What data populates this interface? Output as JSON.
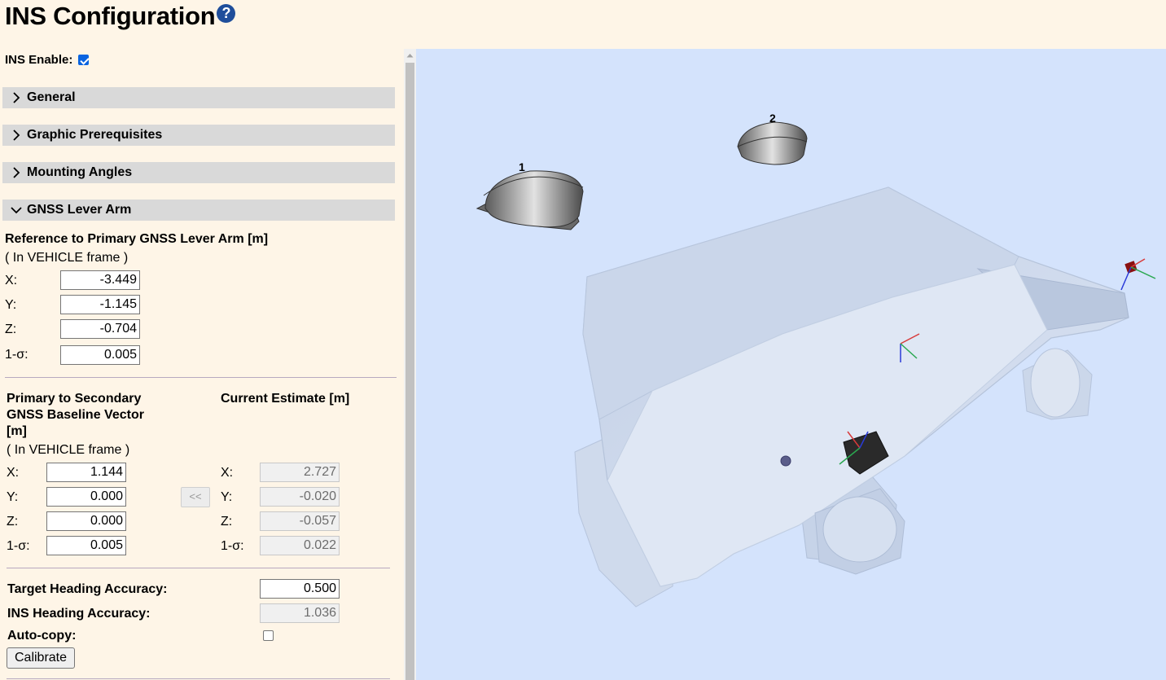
{
  "page": {
    "title": "INS Configuration",
    "help_glyph": "?"
  },
  "ins_enable": {
    "label": "INS Enable:",
    "checked": true
  },
  "sections": [
    {
      "label": "General",
      "expanded": false
    },
    {
      "label": "Graphic Prerequisites",
      "expanded": false
    },
    {
      "label": "Mounting Angles",
      "expanded": false
    },
    {
      "label": "GNSS Lever Arm",
      "expanded": true
    }
  ],
  "lever_arm": {
    "heading": "Reference to Primary GNSS Lever Arm [m]",
    "frame_note": "( In VEHICLE frame )",
    "rows": [
      {
        "label": "X:",
        "value": "-3.449"
      },
      {
        "label": "Y:",
        "value": "-1.145"
      },
      {
        "label": "Z:",
        "value": "-0.704"
      },
      {
        "label": "1-σ:",
        "value": "0.005"
      }
    ]
  },
  "baseline": {
    "heading_line1": "Primary to Secondary",
    "heading_line2": "GNSS Baseline Vector",
    "heading_line3": "[m]",
    "frame_note": "( In VEHICLE frame )",
    "rows": [
      {
        "label": "X:",
        "value": "1.144"
      },
      {
        "label": "Y:",
        "value": "0.000"
      },
      {
        "label": "Z:",
        "value": "0.000"
      },
      {
        "label": "1-σ:",
        "value": "0.005"
      }
    ],
    "copy_label": "<<"
  },
  "estimate": {
    "heading": "Current Estimate [m]",
    "rows": [
      {
        "label": "X:",
        "value": "2.727"
      },
      {
        "label": "Y:",
        "value": "-0.020"
      },
      {
        "label": "Z:",
        "value": "-0.057"
      },
      {
        "label": "1-σ:",
        "value": "0.022"
      }
    ]
  },
  "heading_accuracy": {
    "target_label": "Target Heading Accuracy:",
    "target_value": "0.500",
    "ins_label": "INS Heading Accuracy:",
    "ins_value": "1.036",
    "autocopy_label": "Auto-copy:",
    "autocopy_checked": false
  },
  "calibrate_label": "Calibrate",
  "scene": {
    "antenna_1_label": "1",
    "antenna_2_label": "2",
    "background_color": "#d4e3fc",
    "vehicle_color": "#c9d6ea"
  },
  "colors": {
    "page_background": "#fef5e7",
    "section_header": "#d9d9d9",
    "help_icon": "#1f4e9b",
    "checkbox_accent": "#0a64e0"
  }
}
